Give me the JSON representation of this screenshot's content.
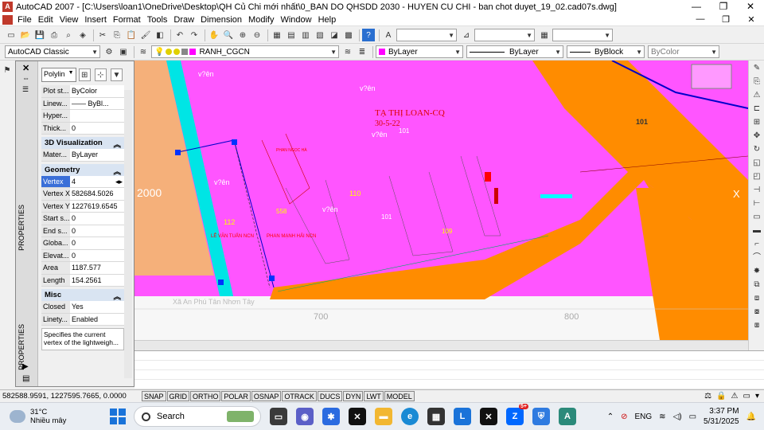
{
  "window": {
    "title": "AutoCAD 2007 - [C:\\Users\\loan1\\OneDrive\\Desktop\\QH Củ Chi mới nhất\\0_BAN DO QHSDD 2030 - HUYEN CU CHI - ban chot duyet_19_02.cad07s.dwg]",
    "controls": [
      "—",
      "❐",
      "✕"
    ]
  },
  "menu": {
    "items": [
      "File",
      "Edit",
      "View",
      "Insert",
      "Format",
      "Tools",
      "Draw",
      "Dimension",
      "Modify",
      "Window",
      "Help"
    ],
    "mdi_controls": [
      "—",
      "❐",
      "✕"
    ]
  },
  "toolbar2": {
    "workspace": "AutoCAD Classic",
    "layer": "RANH_CGCN",
    "color": "ByLayer",
    "linetype": "ByLayer",
    "lineweight": "ByBlock",
    "plotstyle": "ByColor"
  },
  "properties": {
    "palette_label": "PROPERTIES",
    "object_type": "Polylin",
    "general_rows": [
      {
        "key": "Plot st...",
        "value": "ByColor"
      },
      {
        "key": "Linew...",
        "value": "—— ByBl..."
      },
      {
        "key": "Hyper...",
        "value": ""
      },
      {
        "key": "Thick...",
        "value": "0"
      }
    ],
    "viz_header": "3D Visualization",
    "viz_rows": [
      {
        "key": "Mater...",
        "value": "ByLayer"
      }
    ],
    "geom_header": "Geometry",
    "geom_rows": [
      {
        "key": "Vertex",
        "value": "4"
      },
      {
        "key": "Vertex X",
        "value": "582684.5026"
      },
      {
        "key": "Vertex Y",
        "value": "1227619.6545"
      },
      {
        "key": "Start s...",
        "value": "0"
      },
      {
        "key": "End s...",
        "value": "0"
      },
      {
        "key": "Globa...",
        "value": "0"
      },
      {
        "key": "Elevat...",
        "value": "0"
      },
      {
        "key": "Area",
        "value": "1187.577"
      },
      {
        "key": "Length",
        "value": "154.2561"
      }
    ],
    "misc_header": "Misc",
    "misc_rows": [
      {
        "key": "Closed",
        "value": "Yes"
      },
      {
        "key": "Linety...",
        "value": "Enabled"
      }
    ],
    "description": "Specifies the current vertex of the lightweigh..."
  },
  "drawing": {
    "labels": {
      "owner": "TẠ THỊ LOAN-CQ",
      "owner_date": "30-5-22",
      "num_101a": "101",
      "num_101b": "101",
      "num_101c": "101",
      "num_110": "110",
      "num_112": "112",
      "num_558": "558",
      "num_109": "109",
      "grid_2000": "2000",
      "grid_700": "700",
      "grid_800": "800",
      "road": "Xã An Phú Tân Nhơn Tây",
      "vuon_1": "v?ên",
      "vuon_2": "v?ên",
      "vuon_3": "v?ên",
      "vuon_4": "v?ên",
      "vuon_5": "v?ên",
      "name_1": "LÊ VĂN TUẤN NCN",
      "name_2": "PHAN MẠNH HẢI NCN",
      "name_3": "PHAN NGỌC HÀ",
      "x_label": "X"
    }
  },
  "statusbar": {
    "coords": "582588.9591, 1227595.7665, 0.0000",
    "buttons": [
      "SNAP",
      "GRID",
      "ORTHO",
      "POLAR",
      "OSNAP",
      "OTRACK",
      "DUCS",
      "DYN",
      "LWT",
      "MODEL"
    ]
  },
  "taskbar": {
    "temp": "31°C",
    "weather": "Nhiều mây",
    "search_placeholder": "Search",
    "lang": "ENG",
    "time": "3:37 PM",
    "date": "5/31/2025",
    "badge": "5+"
  },
  "colors": {
    "canvas_magenta": "#ff55ff",
    "road_orange": "#ff8c00",
    "cyan_river": "#00e5e5",
    "taskbar_accent": "#1a73d9"
  }
}
